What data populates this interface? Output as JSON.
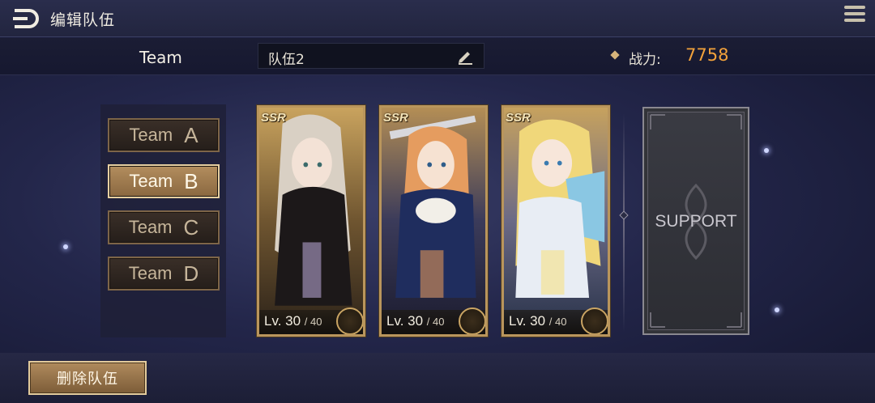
{
  "header": {
    "title": "编辑队伍"
  },
  "info": {
    "team_label": "Team",
    "team_name": "队伍2",
    "power_label": "战力:",
    "power_value": "7758"
  },
  "teams": [
    {
      "word": "Team",
      "letter": "A",
      "active": false
    },
    {
      "word": "Team",
      "letter": "B",
      "active": true
    },
    {
      "word": "Team",
      "letter": "C",
      "active": false
    },
    {
      "word": "Team",
      "letter": "D",
      "active": false
    }
  ],
  "cards": [
    {
      "rarity": "SSR",
      "level": "Lv. 30",
      "max": "/ 40",
      "class_icon": "wings-icon",
      "art": "dark-maiden",
      "accent": "#2a2320"
    },
    {
      "rarity": "SSR",
      "level": "Lv. 30",
      "max": "/ 40",
      "class_icon": "sword-shield-icon",
      "art": "sword-knight",
      "accent": "#1f2d5e"
    },
    {
      "rarity": "SSR",
      "level": "Lv. 30",
      "max": "/ 40",
      "class_icon": "winged-staff-icon",
      "art": "angel-maid",
      "accent": "#4d5c86"
    }
  ],
  "support": {
    "label": "SUPPORT"
  },
  "footer": {
    "delete_label": "删除队伍"
  },
  "colors": {
    "gold": "#b9955c",
    "power": "#f3a23b"
  }
}
